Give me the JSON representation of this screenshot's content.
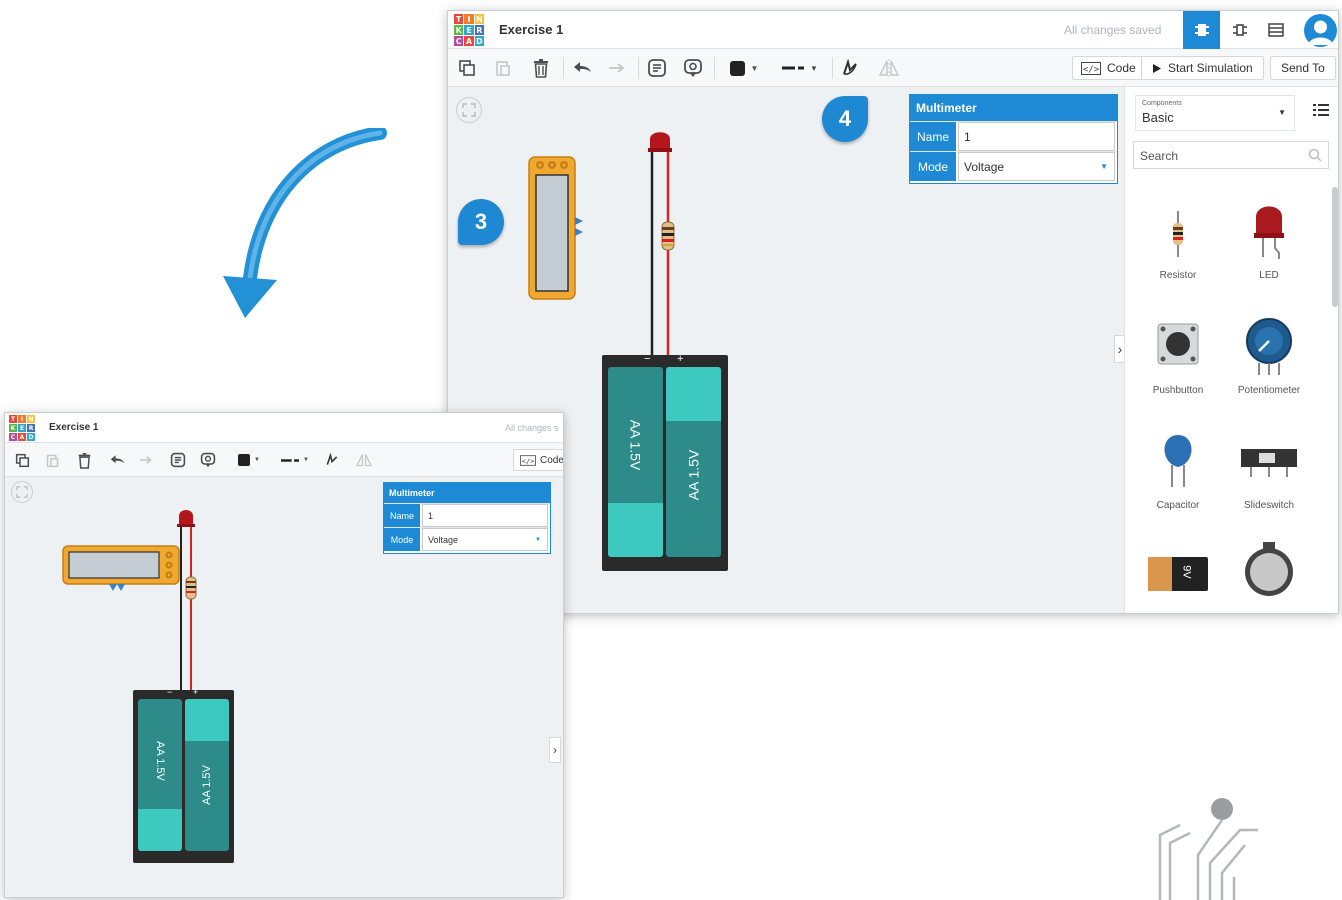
{
  "app": {
    "logo_letters": [
      "T",
      "I",
      "N",
      "K",
      "E",
      "R",
      "C",
      "A",
      "D"
    ],
    "logo_colors": [
      "#e8483b",
      "#f07c27",
      "#f5c23e",
      "#58b947",
      "#2fa7d1",
      "#4471b5",
      "#b64c9a",
      "#e8483b",
      "#2fa7d1"
    ],
    "project_title": "Exercise 1",
    "saved_status": "All changes saved",
    "saved_status_truncated": "All changes s"
  },
  "toolbar": {
    "code_label": "Code",
    "start_simulation_label": "Start Simulation",
    "send_to_label": "Send To"
  },
  "inspector": {
    "title": "Multimeter",
    "name_label": "Name",
    "name_value": "1",
    "mode_label": "Mode",
    "mode_value": "Voltage"
  },
  "components_panel": {
    "category_caption": "Components",
    "category_value": "Basic",
    "search_placeholder": "Search",
    "items": [
      {
        "label": "Resistor"
      },
      {
        "label": "LED"
      },
      {
        "label": "Pushbutton"
      },
      {
        "label": "Potentiometer"
      },
      {
        "label": "Capacitor"
      },
      {
        "label": "Slideswitch"
      }
    ],
    "battery_9v_text": "9V"
  },
  "battery_pack": {
    "cell_left_text": "AA 1.5V",
    "cell_right_text": "AA 1.5V",
    "minus": "−",
    "plus": "+"
  },
  "callouts": {
    "step_3": "3",
    "step_4": "4"
  },
  "colors": {
    "accent": "#1e8ad6",
    "battery_teal": "#2d8c8a",
    "battery_cap": "#3ec9c0",
    "multimeter_orange": "#f0a830",
    "led_red": "#b3161b"
  },
  "icons": {
    "copy": "copy-icon",
    "paste": "paste-icon",
    "delete": "trash-icon",
    "undo": "undo-arrow-icon",
    "redo": "redo-arrow-icon",
    "notes": "notes-icon",
    "toggle_notes": "speech-bubble-icon",
    "color": "color-square-icon",
    "line_style": "line-style-icon",
    "rotate": "rotate-icon",
    "flip": "flip-icon",
    "code": "code-icon",
    "play": "play-icon"
  }
}
